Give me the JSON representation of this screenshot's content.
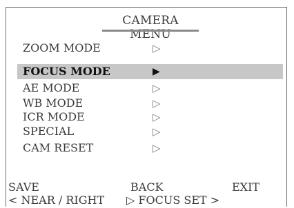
{
  "title": "CAMERA MENU",
  "items": [
    {
      "label": "ZOOM MODE",
      "arrow": "▷"
    },
    {
      "label": "FOCUS MODE",
      "arrow": "▶"
    },
    {
      "label": "AE  MODE",
      "arrow": "▷"
    },
    {
      "label": "WB  MODE",
      "arrow": "▷"
    },
    {
      "label": "ICR  MODE",
      "arrow": "▷"
    },
    {
      "label": "SPECIAL",
      "arrow": "▷"
    },
    {
      "label": "CAM  RESET",
      "arrow": "▷"
    }
  ],
  "selected_index": 1,
  "actions": {
    "save": "SAVE",
    "back": "BACK",
    "exit": "EXIT"
  },
  "hint": {
    "near_right": "< NEAR / RIGHT",
    "focus_set": "▷ FOCUS SET >"
  }
}
